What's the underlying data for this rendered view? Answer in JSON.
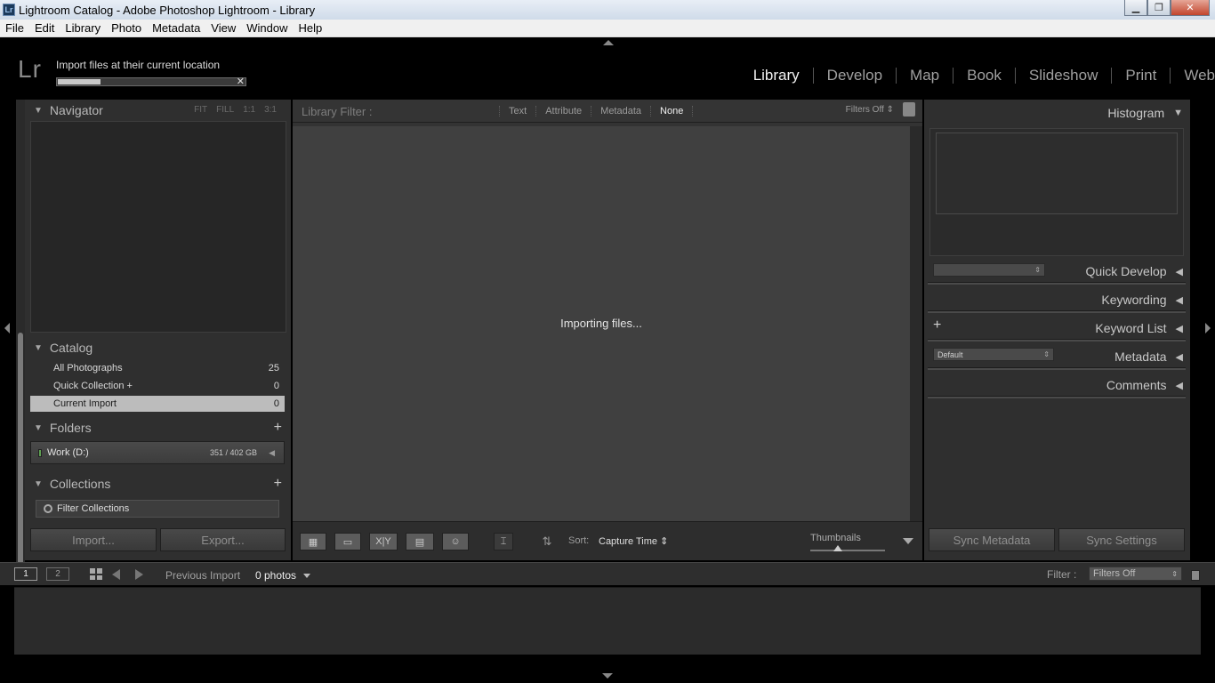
{
  "window": {
    "title": "Lightroom Catalog - Adobe Photoshop Lightroom - Library",
    "icon_label": "Lr"
  },
  "menu": [
    "File",
    "Edit",
    "Library",
    "Photo",
    "Metadata",
    "View",
    "Window",
    "Help"
  ],
  "identity": {
    "logo": "Lr",
    "status": "Import files at their current location",
    "progress": 0.23
  },
  "modules": [
    "Library",
    "Develop",
    "Map",
    "Book",
    "Slideshow",
    "Print",
    "Web"
  ],
  "active_module": "Library",
  "left_panel": {
    "navigator": {
      "title": "Navigator",
      "options": [
        "FIT",
        "FILL",
        "1:1",
        "3:1"
      ]
    },
    "catalog": {
      "title": "Catalog",
      "items": [
        {
          "label": "All Photographs",
          "count": "25"
        },
        {
          "label": "Quick Collection +",
          "count": "0"
        },
        {
          "label": "Current Import",
          "count": "0"
        }
      ]
    },
    "folders": {
      "title": "Folders",
      "plus": "+",
      "drive": {
        "name": "Work (D:)",
        "size": "351 / 402 GB"
      }
    },
    "collections": {
      "title": "Collections",
      "plus": "+",
      "search_placeholder": "Filter Collections"
    },
    "import_button": "Import...",
    "export_button": "Export..."
  },
  "library_filter": {
    "label": "Library Filter :",
    "tabs": [
      "Text",
      "Attribute",
      "Metadata",
      "None"
    ],
    "selected_tab": "None",
    "filters_off": "Filters Off"
  },
  "grid": {
    "message": "Importing files..."
  },
  "toolbar": {
    "sort_label": "Sort:",
    "sort_value": "Capture Time",
    "thumbnails_label": "Thumbnails",
    "compare_label": "X|Y"
  },
  "right_panel": {
    "histogram": "Histogram",
    "quick_develop": "Quick Develop",
    "keywording": "Keywording",
    "keyword_list": "Keyword List",
    "metadata": "Metadata",
    "metadata_preset": "Default",
    "comments": "Comments",
    "sync_metadata": "Sync Metadata",
    "sync_settings": "Sync Settings"
  },
  "filmstrip": {
    "screen1": "1",
    "screen2": "2",
    "source": "Previous Import",
    "photos": "0 photos",
    "filter_label": "Filter :",
    "filter_value": "Filters Off"
  }
}
